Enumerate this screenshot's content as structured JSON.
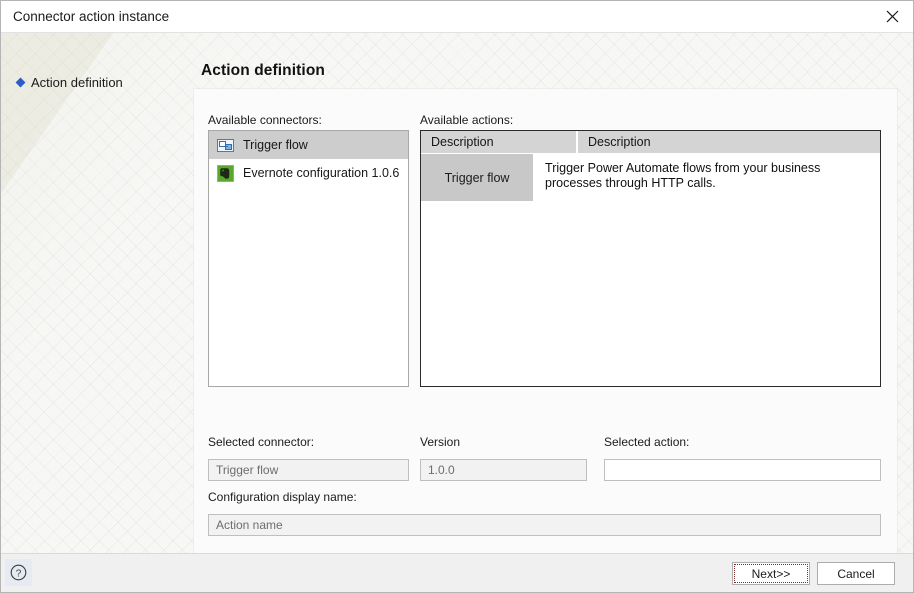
{
  "window": {
    "title": "Connector action instance",
    "close_icon": "close-icon"
  },
  "sidebar": {
    "items": [
      {
        "label": "Action definition",
        "bullet_color": "#2f5bc4",
        "selected": true
      }
    ]
  },
  "main": {
    "page_title": "Action definition",
    "connectors": {
      "label": "Available connectors:",
      "items": [
        {
          "label": "Trigger flow",
          "icon": "trigger-flow-icon",
          "selected": true
        },
        {
          "label": "Evernote configuration 1.0.6",
          "icon": "evernote-icon",
          "selected": false
        }
      ]
    },
    "actions": {
      "label": "Available actions:",
      "columns": [
        "Description",
        "Description"
      ],
      "rows": [
        {
          "name": "Trigger flow",
          "description": "Trigger Power Automate flows from your business processes through HTTP calls."
        }
      ]
    },
    "fields": {
      "selected_connector": {
        "label": "Selected connector:",
        "value": "Trigger flow",
        "placeholder": ""
      },
      "version": {
        "label": "Version",
        "value": "1.0.0",
        "placeholder": ""
      },
      "selected_action": {
        "label": "Selected action:",
        "value": "",
        "placeholder": ""
      },
      "configuration_display_name": {
        "label": "Configuration display name:",
        "value": "",
        "placeholder": "Action name"
      }
    }
  },
  "footer": {
    "help_icon": "help-icon",
    "next_label": "Next>>",
    "cancel_label": "Cancel"
  }
}
